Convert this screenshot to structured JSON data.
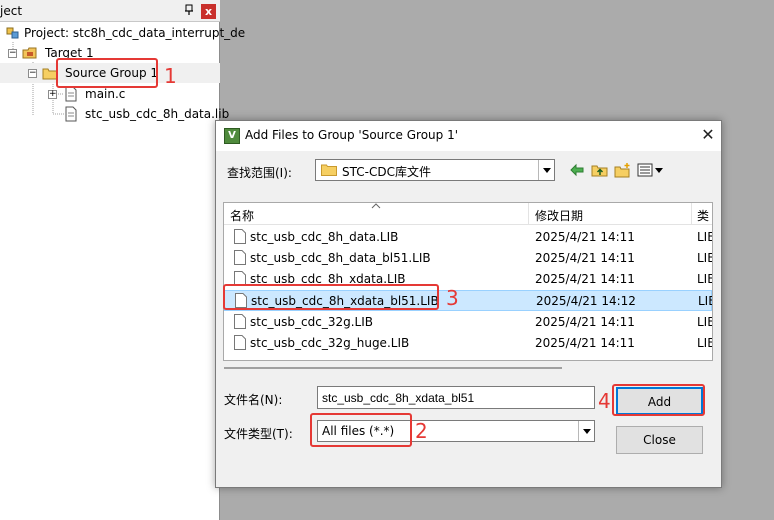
{
  "project_panel": {
    "title": "ject",
    "close_glyph": "x",
    "tree": [
      {
        "label": "Project: stc8h_cdc_data_interrupt_de"
      },
      {
        "label": "Target 1"
      },
      {
        "label": "Source Group 1"
      },
      {
        "label": "main.c"
      },
      {
        "label": "stc_usb_cdc_8h_data.lib"
      }
    ]
  },
  "dialog": {
    "title": "Add Files to Group 'Source Group 1'",
    "close_glyph": "✕",
    "app_icon_glyph": "V",
    "look_in_label": "查找范围(I):",
    "look_in_value": "STC-CDC库文件",
    "columns": {
      "name": "名称",
      "date": "修改日期",
      "type": "类"
    },
    "files": [
      {
        "name": "stc_usb_cdc_8h_data.LIB",
        "date": "2025/4/21 14:11",
        "type": "LIB"
      },
      {
        "name": "stc_usb_cdc_8h_data_bl51.LIB",
        "date": "2025/4/21 14:11",
        "type": "LIB"
      },
      {
        "name": "stc_usb_cdc_8h_xdata.LIB",
        "date": "2025/4/21 14:11",
        "type": "LIB"
      },
      {
        "name": "stc_usb_cdc_8h_xdata_bl51.LIB",
        "date": "2025/4/21 14:12",
        "type": "LIB"
      },
      {
        "name": "stc_usb_cdc_32g.LIB",
        "date": "2025/4/21 14:11",
        "type": "LIB"
      },
      {
        "name": "stc_usb_cdc_32g_huge.LIB",
        "date": "2025/4/21 14:11",
        "type": "LIB"
      }
    ],
    "selected_index": 3,
    "filename_label": "文件名(N):",
    "filename_value": "stc_usb_cdc_8h_xdata_bl51",
    "filetype_label": "文件类型(T):",
    "filetype_value": "All files (*.*)",
    "add_label": "Add",
    "close_label": "Close"
  },
  "annotations": [
    "1",
    "2",
    "3",
    "4"
  ],
  "colors": {
    "annotation": "#e53935",
    "selection": "#cce8ff",
    "accent": "#0078d7"
  },
  "icons": [
    "pin-icon",
    "project-icon",
    "target-icon",
    "folder-icon",
    "file-icon",
    "back-icon",
    "up-folder-icon",
    "new-folder-icon",
    "view-menu-icon",
    "close-icon",
    "sort-arrow-icon"
  ]
}
